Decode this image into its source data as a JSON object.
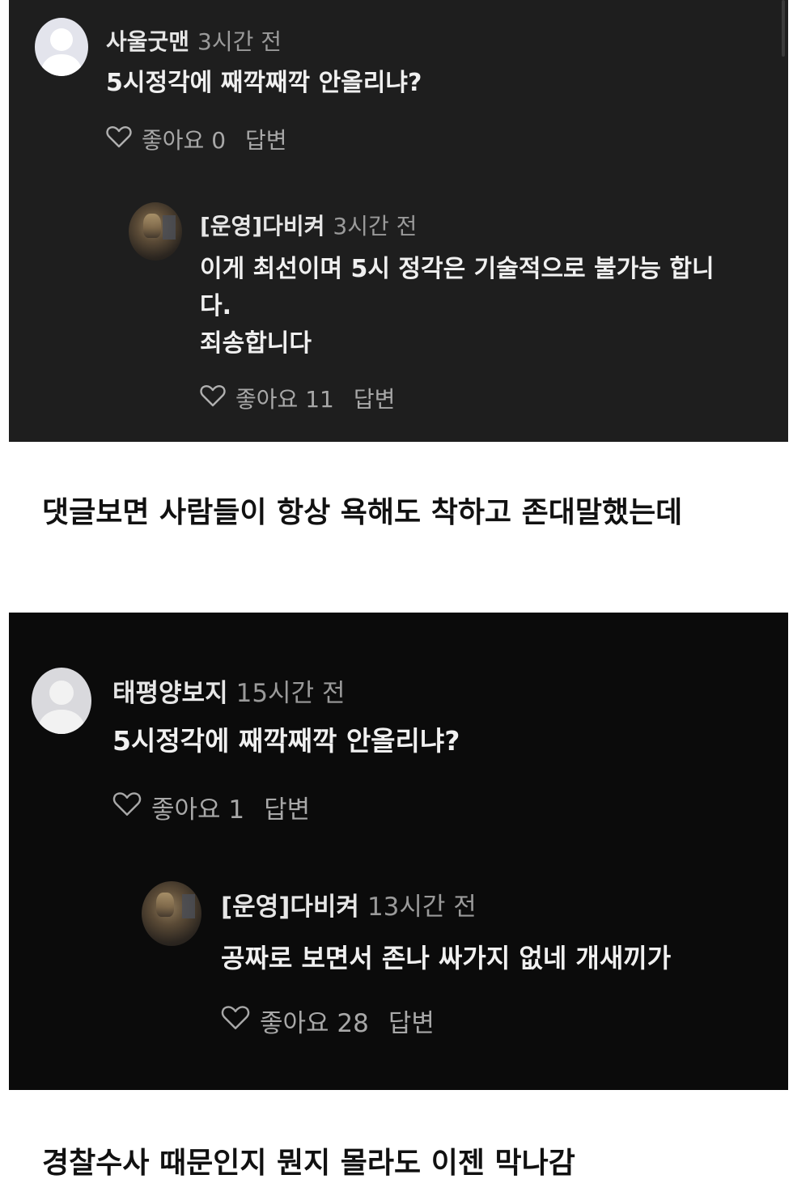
{
  "screens": [
    {
      "comment": {
        "author": "사울굿맨",
        "time": "3시간 전",
        "text": "5시정각에 째깍째깍 안올리냐?",
        "like_label": "좋아요",
        "like_count": "0",
        "reply_label": "답변"
      },
      "reply": {
        "author": "[운영]다비켜",
        "time": "3시간 전",
        "text_lines": [
          "이게 최선이며 5시 정각은 기술적으로 불가능 합니",
          "다.",
          "죄송합니다"
        ],
        "like_label": "좋아요",
        "like_count": "11",
        "reply_label": "답변"
      }
    },
    {
      "comment": {
        "author": "태평양보지",
        "time": "15시간 전",
        "text": "5시정각에 째깍째깍 안올리냐?",
        "like_label": "좋아요",
        "like_count": "1",
        "reply_label": "답변"
      },
      "reply": {
        "author": "[운영]다비켜",
        "time": "13시간 전",
        "text": "공짜로 보면서 존나 싸가지 없네 개새끼가",
        "like_label": "좋아요",
        "like_count": "28",
        "reply_label": "답변"
      }
    }
  ],
  "captions": [
    "댓글보면 사람들이 항상 욕해도 착하고 존대말했는데",
    "경찰수사 때문인지 뭔지 몰라도 이젠 막나감"
  ],
  "icons": {
    "avatar_default": "default-user-avatar-icon",
    "like": "heart-outline-icon"
  },
  "colors": {
    "panel_bg": "#1e1e1e",
    "panel2_bg": "#0b0b0b",
    "text": "#f0f0f0",
    "muted": "#9a9a9a",
    "caption": "#111111"
  }
}
